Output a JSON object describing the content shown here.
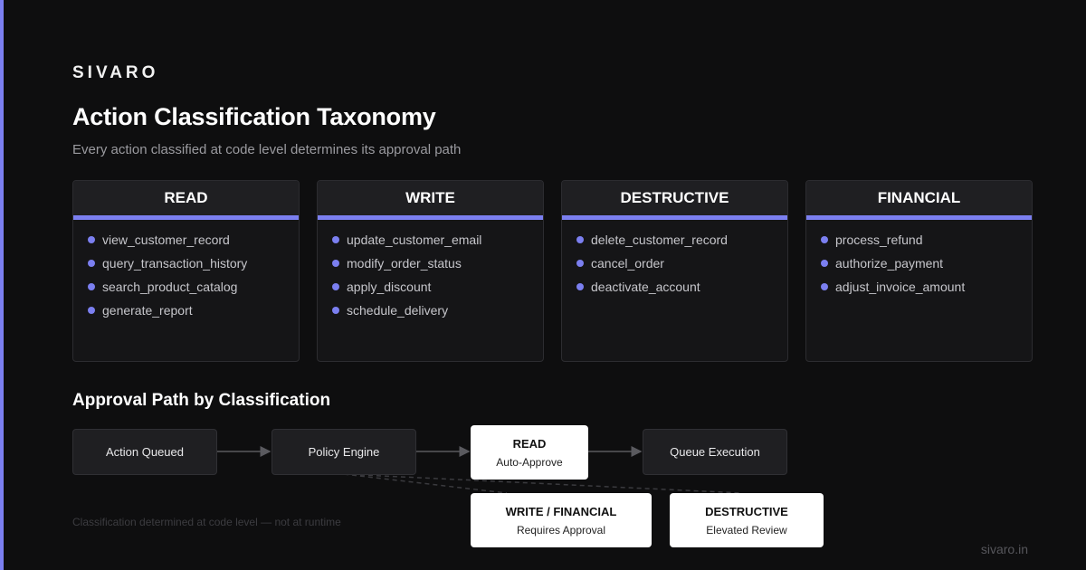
{
  "brand": "SIVARO",
  "title": "Action Classification Taxonomy",
  "subtitle": "Every action classified at code level determines its approval path",
  "categories": [
    {
      "name": "READ",
      "items": [
        "view_customer_record",
        "query_transaction_history",
        "search_product_catalog",
        "generate_report"
      ]
    },
    {
      "name": "WRITE",
      "items": [
        "update_customer_email",
        "modify_order_status",
        "apply_discount",
        "schedule_delivery"
      ]
    },
    {
      "name": "DESTRUCTIVE",
      "items": [
        "delete_customer_record",
        "cancel_order",
        "deactivate_account"
      ]
    },
    {
      "name": "FINANCIAL",
      "items": [
        "process_refund",
        "authorize_payment",
        "adjust_invoice_amount"
      ]
    }
  ],
  "approval": {
    "title": "Approval Path by Classification",
    "action_queued": "Action Queued",
    "policy_engine": "Policy Engine",
    "read_title": "READ",
    "read_sub": "Auto-Approve",
    "queue_execution": "Queue Execution",
    "write_title": "WRITE / FINANCIAL",
    "write_sub": "Requires Approval",
    "destructive_title": "DESTRUCTIVE",
    "destructive_sub": "Elevated Review"
  },
  "footnote": "Classification determined at code level — not at runtime",
  "site": "sivaro.in",
  "colors": {
    "accent": "#7b7ff0",
    "background": "#0e0e0f",
    "card": "#151517"
  }
}
